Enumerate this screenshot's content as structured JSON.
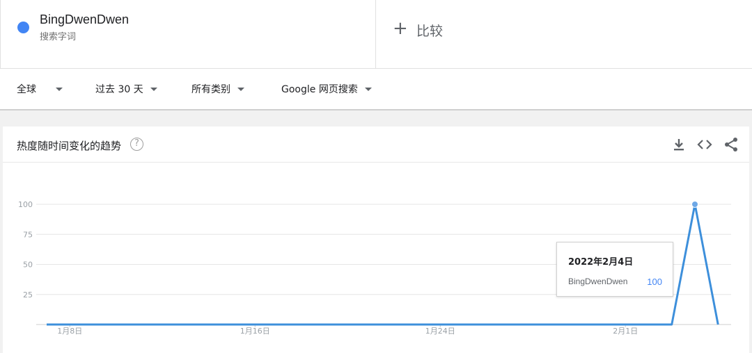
{
  "term": {
    "name": "BingDwenDwen",
    "subtitle": "搜索字词",
    "dot_color": "#4285f4"
  },
  "compare": {
    "icon": "plus-icon",
    "label": "比较"
  },
  "filters": [
    {
      "label": "全球"
    },
    {
      "label": "过去 30 天"
    },
    {
      "label": "所有类别"
    },
    {
      "label": "Google 网页搜索"
    }
  ],
  "chart_header": {
    "title": "热度随时间变化的趋势",
    "help_icon": "help-icon",
    "actions": [
      "download-icon",
      "embed-code-icon",
      "share-icon"
    ]
  },
  "tooltip": {
    "date": "2022年2月4日",
    "series": "BingDwenDwen",
    "value": "100"
  },
  "chart_data": {
    "type": "line",
    "x": [
      "2022-01-07",
      "2022-01-08",
      "2022-01-09",
      "2022-01-10",
      "2022-01-11",
      "2022-01-12",
      "2022-01-13",
      "2022-01-14",
      "2022-01-15",
      "2022-01-16",
      "2022-01-17",
      "2022-01-18",
      "2022-01-19",
      "2022-01-20",
      "2022-01-21",
      "2022-01-22",
      "2022-01-23",
      "2022-01-24",
      "2022-01-25",
      "2022-01-26",
      "2022-01-27",
      "2022-01-28",
      "2022-01-29",
      "2022-01-30",
      "2022-01-31",
      "2022-02-01",
      "2022-02-02",
      "2022-02-03",
      "2022-02-04",
      "2022-02-05"
    ],
    "series": [
      {
        "name": "BingDwenDwen",
        "color": "#3d8fdb",
        "values": [
          0,
          0,
          0,
          0,
          0,
          0,
          0,
          0,
          0,
          0,
          0,
          0,
          0,
          0,
          0,
          0,
          0,
          0,
          0,
          0,
          0,
          0,
          0,
          0,
          0,
          0,
          0,
          0,
          100,
          0
        ]
      }
    ],
    "ylim": [
      0,
      100
    ],
    "yticks": [
      25,
      50,
      75,
      100
    ],
    "xtick_labels": [
      "1月8日",
      "1月16日",
      "1月24日",
      "2月1日"
    ],
    "xtick_index": [
      1,
      9,
      17,
      25
    ],
    "highlight_index": 28,
    "grid": true
  }
}
